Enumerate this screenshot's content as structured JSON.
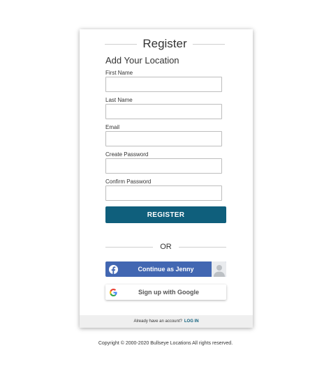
{
  "card": {
    "title": "Register",
    "subtitle": "Add Your Location"
  },
  "form": {
    "fields": [
      {
        "label": "First Name",
        "value": "",
        "placeholder": ""
      },
      {
        "label": "Last Name",
        "value": "",
        "placeholder": ""
      },
      {
        "label": "Email",
        "value": "",
        "placeholder": ""
      },
      {
        "label": "Create Password",
        "value": "",
        "placeholder": ""
      },
      {
        "label": "Confirm Password",
        "value": "",
        "placeholder": ""
      }
    ],
    "register_label": "REGISTER"
  },
  "divider": {
    "or_label": "OR"
  },
  "social": {
    "facebook_label": "Continue as Jenny",
    "google_label": "Sign up with Google"
  },
  "footer": {
    "account_text": "Already have an account?",
    "login_label": "LOG IN"
  },
  "copyright": "Copyright © 2000-2020 Bullseye Locations All rights reserved.",
  "colors": {
    "primary": "#0f5f7c",
    "facebook": "#4267b2",
    "footer_bg": "#efefef"
  },
  "icons": {
    "facebook": "facebook-icon",
    "google": "google-icon",
    "avatar": "user-avatar-icon"
  }
}
